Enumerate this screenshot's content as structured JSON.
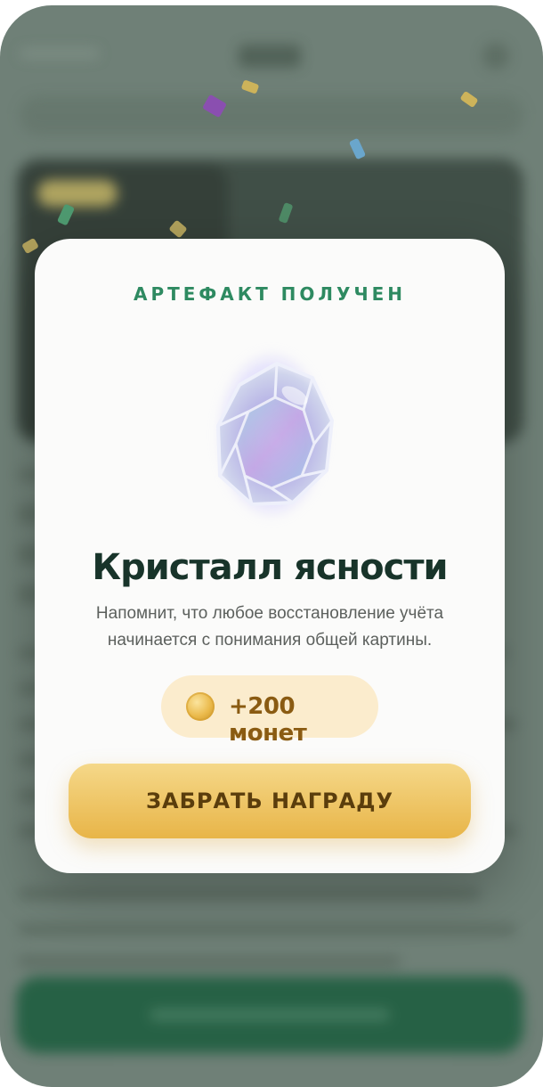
{
  "modal": {
    "kicker": "АРТЕФАКТ ПОЛУЧЕН",
    "artifact_icon": "crystal-gem-icon",
    "title": "Кристалл ясности",
    "description": "Напомнит, что любое восстановление учёта начинается с понимания общей картины.",
    "reward": {
      "icon": "coin-icon",
      "label": "+200 монет"
    },
    "claim_button_label": "ЗАБРАТЬ НАГРАДУ"
  },
  "colors": {
    "accent_green": "#2e8a61",
    "title_dark": "#18342a",
    "gold": "#e8b548",
    "overlay": "#6f8077"
  }
}
